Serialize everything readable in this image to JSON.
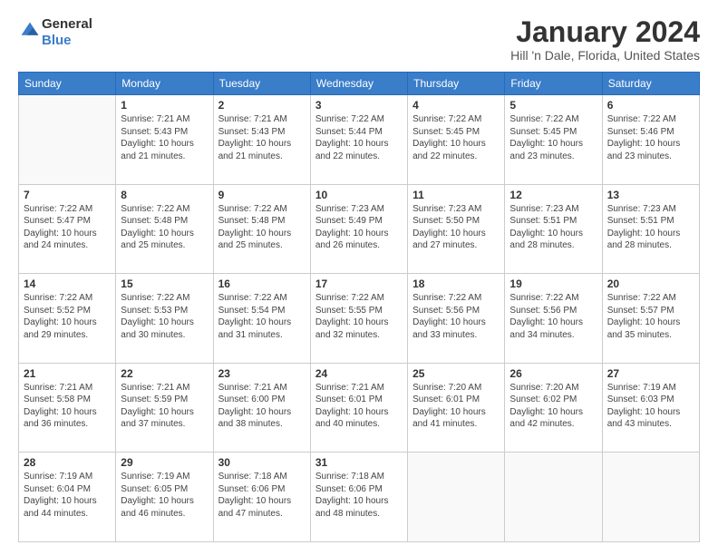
{
  "logo": {
    "line1": "General",
    "line2": "Blue"
  },
  "title": "January 2024",
  "subtitle": "Hill 'n Dale, Florida, United States",
  "days_of_week": [
    "Sunday",
    "Monday",
    "Tuesday",
    "Wednesday",
    "Thursday",
    "Friday",
    "Saturday"
  ],
  "weeks": [
    [
      {
        "day": "",
        "sunrise": "",
        "sunset": "",
        "daylight": ""
      },
      {
        "day": "1",
        "sunrise": "Sunrise: 7:21 AM",
        "sunset": "Sunset: 5:43 PM",
        "daylight": "Daylight: 10 hours and 21 minutes."
      },
      {
        "day": "2",
        "sunrise": "Sunrise: 7:21 AM",
        "sunset": "Sunset: 5:43 PM",
        "daylight": "Daylight: 10 hours and 21 minutes."
      },
      {
        "day": "3",
        "sunrise": "Sunrise: 7:22 AM",
        "sunset": "Sunset: 5:44 PM",
        "daylight": "Daylight: 10 hours and 22 minutes."
      },
      {
        "day": "4",
        "sunrise": "Sunrise: 7:22 AM",
        "sunset": "Sunset: 5:45 PM",
        "daylight": "Daylight: 10 hours and 22 minutes."
      },
      {
        "day": "5",
        "sunrise": "Sunrise: 7:22 AM",
        "sunset": "Sunset: 5:45 PM",
        "daylight": "Daylight: 10 hours and 23 minutes."
      },
      {
        "day": "6",
        "sunrise": "Sunrise: 7:22 AM",
        "sunset": "Sunset: 5:46 PM",
        "daylight": "Daylight: 10 hours and 23 minutes."
      }
    ],
    [
      {
        "day": "7",
        "sunrise": "Sunrise: 7:22 AM",
        "sunset": "Sunset: 5:47 PM",
        "daylight": "Daylight: 10 hours and 24 minutes."
      },
      {
        "day": "8",
        "sunrise": "Sunrise: 7:22 AM",
        "sunset": "Sunset: 5:48 PM",
        "daylight": "Daylight: 10 hours and 25 minutes."
      },
      {
        "day": "9",
        "sunrise": "Sunrise: 7:22 AM",
        "sunset": "Sunset: 5:48 PM",
        "daylight": "Daylight: 10 hours and 25 minutes."
      },
      {
        "day": "10",
        "sunrise": "Sunrise: 7:23 AM",
        "sunset": "Sunset: 5:49 PM",
        "daylight": "Daylight: 10 hours and 26 minutes."
      },
      {
        "day": "11",
        "sunrise": "Sunrise: 7:23 AM",
        "sunset": "Sunset: 5:50 PM",
        "daylight": "Daylight: 10 hours and 27 minutes."
      },
      {
        "day": "12",
        "sunrise": "Sunrise: 7:23 AM",
        "sunset": "Sunset: 5:51 PM",
        "daylight": "Daylight: 10 hours and 28 minutes."
      },
      {
        "day": "13",
        "sunrise": "Sunrise: 7:23 AM",
        "sunset": "Sunset: 5:51 PM",
        "daylight": "Daylight: 10 hours and 28 minutes."
      }
    ],
    [
      {
        "day": "14",
        "sunrise": "Sunrise: 7:22 AM",
        "sunset": "Sunset: 5:52 PM",
        "daylight": "Daylight: 10 hours and 29 minutes."
      },
      {
        "day": "15",
        "sunrise": "Sunrise: 7:22 AM",
        "sunset": "Sunset: 5:53 PM",
        "daylight": "Daylight: 10 hours and 30 minutes."
      },
      {
        "day": "16",
        "sunrise": "Sunrise: 7:22 AM",
        "sunset": "Sunset: 5:54 PM",
        "daylight": "Daylight: 10 hours and 31 minutes."
      },
      {
        "day": "17",
        "sunrise": "Sunrise: 7:22 AM",
        "sunset": "Sunset: 5:55 PM",
        "daylight": "Daylight: 10 hours and 32 minutes."
      },
      {
        "day": "18",
        "sunrise": "Sunrise: 7:22 AM",
        "sunset": "Sunset: 5:56 PM",
        "daylight": "Daylight: 10 hours and 33 minutes."
      },
      {
        "day": "19",
        "sunrise": "Sunrise: 7:22 AM",
        "sunset": "Sunset: 5:56 PM",
        "daylight": "Daylight: 10 hours and 34 minutes."
      },
      {
        "day": "20",
        "sunrise": "Sunrise: 7:22 AM",
        "sunset": "Sunset: 5:57 PM",
        "daylight": "Daylight: 10 hours and 35 minutes."
      }
    ],
    [
      {
        "day": "21",
        "sunrise": "Sunrise: 7:21 AM",
        "sunset": "Sunset: 5:58 PM",
        "daylight": "Daylight: 10 hours and 36 minutes."
      },
      {
        "day": "22",
        "sunrise": "Sunrise: 7:21 AM",
        "sunset": "Sunset: 5:59 PM",
        "daylight": "Daylight: 10 hours and 37 minutes."
      },
      {
        "day": "23",
        "sunrise": "Sunrise: 7:21 AM",
        "sunset": "Sunset: 6:00 PM",
        "daylight": "Daylight: 10 hours and 38 minutes."
      },
      {
        "day": "24",
        "sunrise": "Sunrise: 7:21 AM",
        "sunset": "Sunset: 6:01 PM",
        "daylight": "Daylight: 10 hours and 40 minutes."
      },
      {
        "day": "25",
        "sunrise": "Sunrise: 7:20 AM",
        "sunset": "Sunset: 6:01 PM",
        "daylight": "Daylight: 10 hours and 41 minutes."
      },
      {
        "day": "26",
        "sunrise": "Sunrise: 7:20 AM",
        "sunset": "Sunset: 6:02 PM",
        "daylight": "Daylight: 10 hours and 42 minutes."
      },
      {
        "day": "27",
        "sunrise": "Sunrise: 7:19 AM",
        "sunset": "Sunset: 6:03 PM",
        "daylight": "Daylight: 10 hours and 43 minutes."
      }
    ],
    [
      {
        "day": "28",
        "sunrise": "Sunrise: 7:19 AM",
        "sunset": "Sunset: 6:04 PM",
        "daylight": "Daylight: 10 hours and 44 minutes."
      },
      {
        "day": "29",
        "sunrise": "Sunrise: 7:19 AM",
        "sunset": "Sunset: 6:05 PM",
        "daylight": "Daylight: 10 hours and 46 minutes."
      },
      {
        "day": "30",
        "sunrise": "Sunrise: 7:18 AM",
        "sunset": "Sunset: 6:06 PM",
        "daylight": "Daylight: 10 hours and 47 minutes."
      },
      {
        "day": "31",
        "sunrise": "Sunrise: 7:18 AM",
        "sunset": "Sunset: 6:06 PM",
        "daylight": "Daylight: 10 hours and 48 minutes."
      },
      {
        "day": "",
        "sunrise": "",
        "sunset": "",
        "daylight": ""
      },
      {
        "day": "",
        "sunrise": "",
        "sunset": "",
        "daylight": ""
      },
      {
        "day": "",
        "sunrise": "",
        "sunset": "",
        "daylight": ""
      }
    ]
  ]
}
